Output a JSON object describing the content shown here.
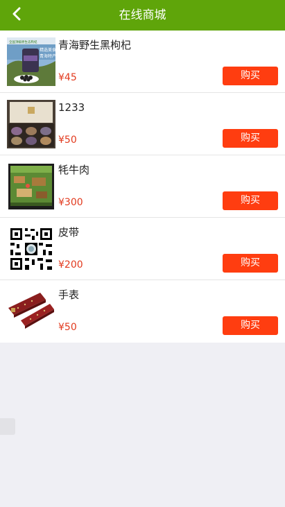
{
  "header": {
    "title": "在线商城",
    "back_icon": "chevron-left-icon"
  },
  "products": [
    {
      "name": "青海野生黑枸杞",
      "price": "¥45",
      "buy_label": "购买",
      "thumb_text_1": "全国顶级原生态枸杞",
      "thumb_text_2": "精选美食",
      "thumb_text_3": "青海特产"
    },
    {
      "name": "1233",
      "price": "¥50",
      "buy_label": "购买"
    },
    {
      "name": "牦牛肉",
      "price": "¥300",
      "buy_label": "购买"
    },
    {
      "name": "皮带",
      "price": "¥200",
      "buy_label": "购买"
    },
    {
      "name": "手表",
      "price": "¥50",
      "buy_label": "购买"
    }
  ],
  "colors": {
    "header_bg": "#5fa50a",
    "buy_button": "#ff3d10",
    "price": "#e23a1e",
    "page_bg": "#efeff4"
  }
}
